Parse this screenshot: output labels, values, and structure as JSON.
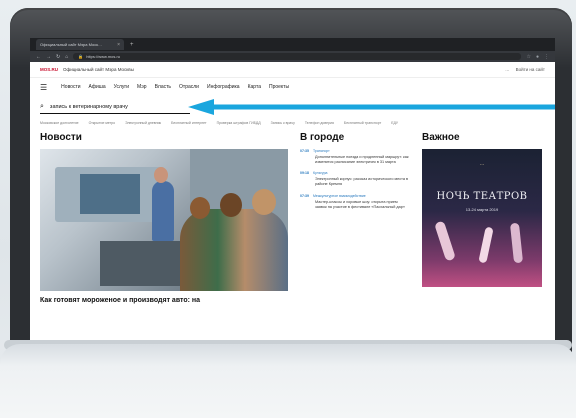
{
  "browser": {
    "tab_label": "Официальный сайт Мэра Моск…",
    "url": "https://www.mos.ru"
  },
  "site": {
    "brand": "МОS.RU",
    "brand_caption": "Официальный сайт Мэра Москвы",
    "region": "…",
    "login": "Войти на сайт"
  },
  "nav": {
    "items": [
      "Новости",
      "Афиша",
      "Услуги",
      "Мэр",
      "Власть",
      "Отрасли",
      "Инфографика",
      "Карта",
      "Проекты"
    ]
  },
  "search": {
    "value": "запись к ветеринарному врачу"
  },
  "quicklinks": [
    "Московское долголетие",
    "Открытие метро",
    "Электронный дневник",
    "Бесплатный интернет",
    "Проверка штрафов ГИБДД",
    "Запись к врачу",
    "Телефон доверия",
    "Бесплатный транспорт",
    "ЕДУ"
  ],
  "news": {
    "title": "Новости",
    "caption": "Как готовят мороженое и производят авто: на"
  },
  "city": {
    "title": "В городе",
    "items": [
      {
        "time": "07:35",
        "category": "Транспорт",
        "text": "Дополнительные поезда и продленный маршрут: как изменится расписание электричек в 31 марта"
      },
      {
        "time": "09:18",
        "category": "Культура",
        "text": "Электронный корпус: рассказ исторического места в районе Кремля"
      },
      {
        "time": "07:39",
        "category": "Межкультурное взаимодействие",
        "text": "Мастер-классы и хоровые шоу: открыта прием заявок на участие в фестивале «Пасхальный дар»"
      }
    ]
  },
  "important": {
    "title": "Важное",
    "poster_subtitle": "…",
    "poster_title": "НОЧЬ ТЕАТРОВ",
    "poster_date": "13-24 марта 2019"
  },
  "colors": {
    "accent": "#c8102e",
    "arrow": "#1aa6de",
    "link": "#2b7bbf"
  }
}
